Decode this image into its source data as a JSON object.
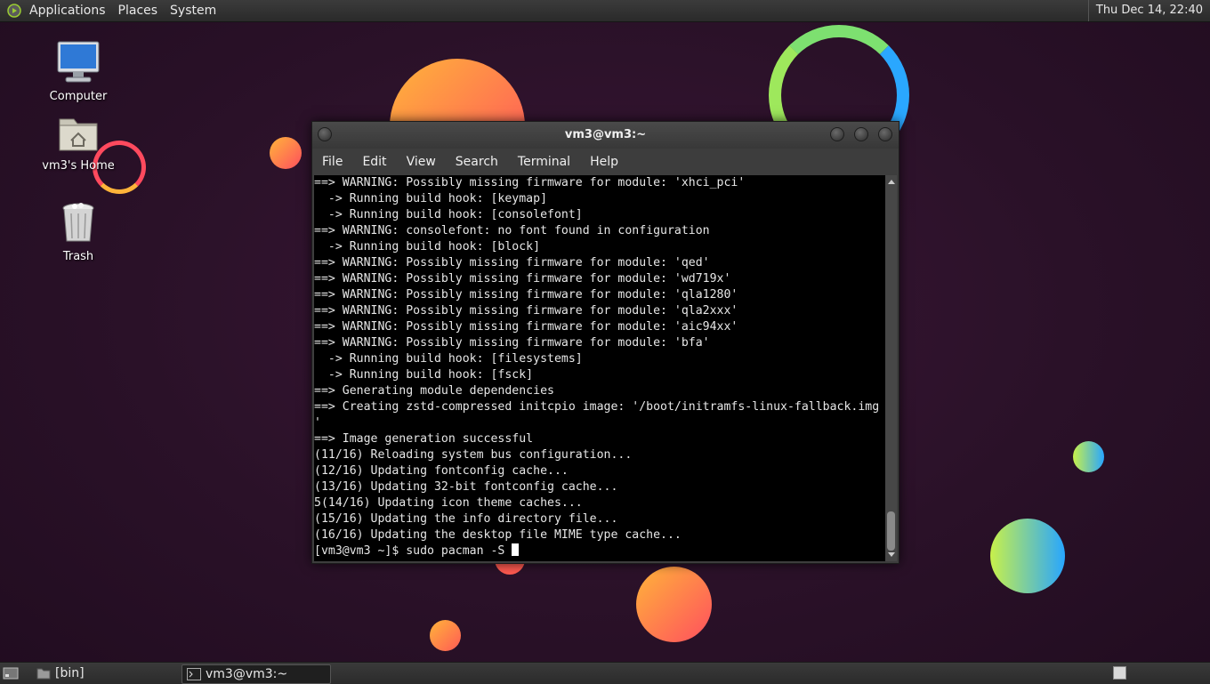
{
  "top_panel": {
    "menus": [
      "Applications",
      "Places",
      "System"
    ],
    "clock": "Thu Dec 14, 22:40"
  },
  "desktop": {
    "icons": [
      {
        "label": "Computer",
        "icon": "computer-icon"
      },
      {
        "label": "vm3's Home",
        "icon": "home-folder-icon"
      },
      {
        "label": "Trash",
        "icon": "trash-icon"
      }
    ]
  },
  "window": {
    "title": "vm3@vm3:~",
    "menus": [
      "File",
      "Edit",
      "View",
      "Search",
      "Terminal",
      "Help"
    ],
    "lines": [
      "==> WARNING: Possibly missing firmware for module: 'xhci_pci'",
      "  -> Running build hook: [keymap]",
      "  -> Running build hook: [consolefont]",
      "==> WARNING: consolefont: no font found in configuration",
      "  -> Running build hook: [block]",
      "==> WARNING: Possibly missing firmware for module: 'qed'",
      "==> WARNING: Possibly missing firmware for module: 'wd719x'",
      "==> WARNING: Possibly missing firmware for module: 'qla1280'",
      "==> WARNING: Possibly missing firmware for module: 'qla2xxx'",
      "==> WARNING: Possibly missing firmware for module: 'aic94xx'",
      "==> WARNING: Possibly missing firmware for module: 'bfa'",
      "  -> Running build hook: [filesystems]",
      "  -> Running build hook: [fsck]",
      "==> Generating module dependencies",
      "==> Creating zstd-compressed initcpio image: '/boot/initramfs-linux-fallback.img",
      "'",
      "==> Image generation successful",
      "(11/16) Reloading system bus configuration...",
      "(12/16) Updating fontconfig cache...",
      "(13/16) Updating 32-bit fontconfig cache...",
      "5(14/16) Updating icon theme caches...",
      "(15/16) Updating the info directory file...",
      "(16/16) Updating the desktop file MIME type cache..."
    ],
    "prompt": "[vm3@vm3 ~]$ sudo pacman -S "
  },
  "bottom_panel": {
    "tasks": [
      {
        "label": "[bin]",
        "icon": "folder-icon"
      },
      {
        "label": "vm3@vm3:~",
        "icon": "terminal-icon"
      }
    ]
  }
}
